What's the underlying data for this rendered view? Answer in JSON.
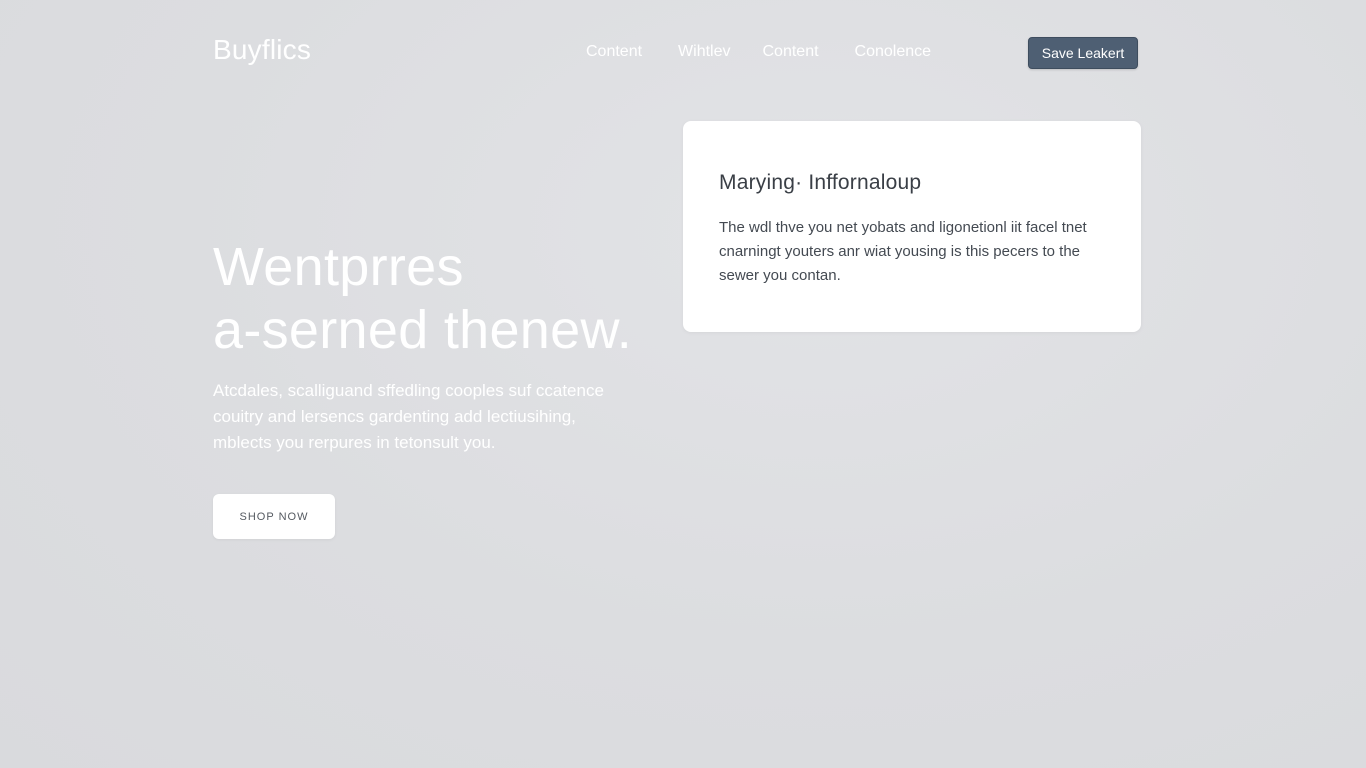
{
  "header": {
    "brand": "Buyflics",
    "nav": [
      "Content",
      "Wihtlev",
      "Content",
      "Conolence"
    ],
    "cta_label": "Save Leakert"
  },
  "hero": {
    "title_lines": [
      "Wentprres",
      "a-serned thenew."
    ],
    "description_lines": [
      "Atcdales, scalliguand sffedling cooples suf ccatence",
      "couitry and lersencs gardenting add lectiusihing,",
      "mblects you rerpures in tetonsult you."
    ],
    "button_label": "SHOP NOW"
  },
  "card": {
    "title": "Marying· Inffornaloup",
    "text_lines": [
      "The wdl thve you net yobats and ligonetionl iit facel tnet",
      "cnarningt youters anr wiat yousing is this pecers to the",
      "sewer you contan."
    ]
  }
}
